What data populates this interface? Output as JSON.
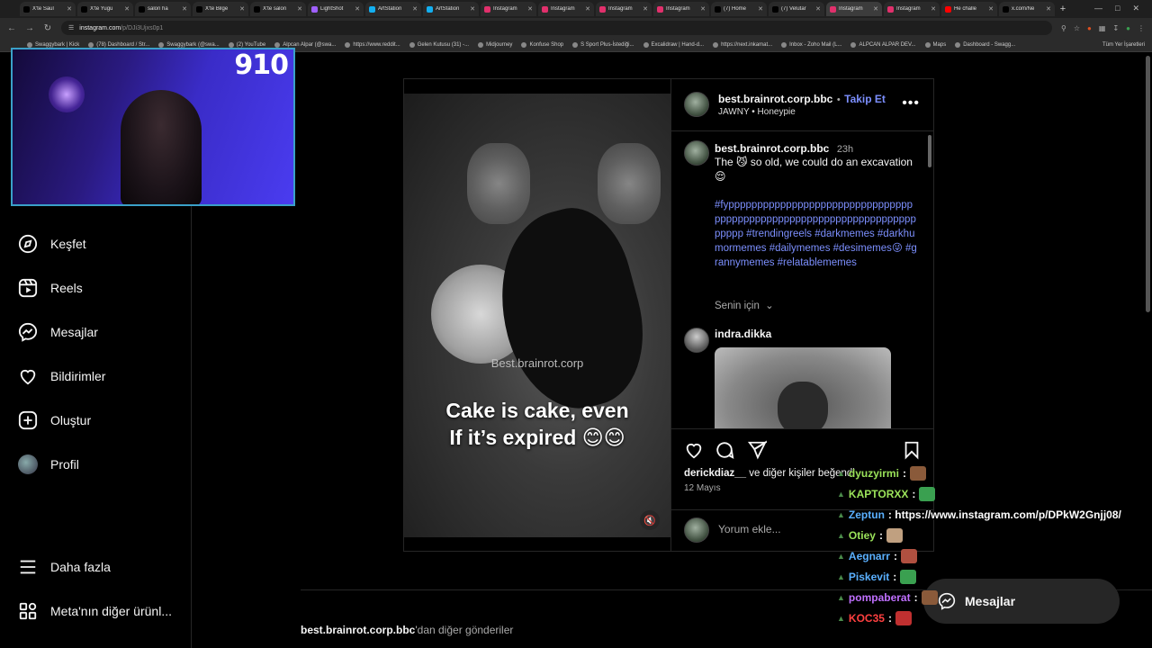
{
  "browser": {
    "tabs": [
      {
        "label": "X'te Saul",
        "color": "#000000"
      },
      {
        "label": "X'te Yugu",
        "color": "#000000"
      },
      {
        "label": "salon ha",
        "color": "#000000"
      },
      {
        "label": "X'te Bilge",
        "color": "#000000"
      },
      {
        "label": "X'te salon",
        "color": "#000000"
      },
      {
        "label": "LightShot",
        "color": "#a060ff"
      },
      {
        "label": "ArtStation",
        "color": "#13aff0"
      },
      {
        "label": "ArtStation",
        "color": "#13aff0"
      },
      {
        "label": "Instagram",
        "color": "#e1306c"
      },
      {
        "label": "Instagram",
        "color": "#e1306c"
      },
      {
        "label": "Instagram",
        "color": "#e1306c"
      },
      {
        "label": "Instagram",
        "color": "#e1306c"
      },
      {
        "label": "(7) Home",
        "color": "#000000"
      },
      {
        "label": "(7) Velutar",
        "color": "#000000"
      },
      {
        "label": "Instagram",
        "color": "#e1306c"
      },
      {
        "label": "Instagram",
        "color": "#e1306c"
      },
      {
        "label": "He challe",
        "color": "#ff0000"
      },
      {
        "label": "x.com/Ne",
        "color": "#000000"
      }
    ],
    "address": {
      "host": "instagram.com",
      "path": "/p/DJi3Ujxs0p1"
    },
    "bookmarks": [
      "Swaggybark | Kick",
      "(78) Dashboard / Str...",
      "Swaggybark (@swa...",
      "(2) YouTube",
      "Alpcan Alpar (@swa...",
      "https://www.reddit...",
      "Gelen Kutusu (31) -...",
      "Midjourney",
      "Konfuse Shop",
      "S Sport Plus-İstediği...",
      "Excalidraw | Hand-d...",
      "https://next.inkamat...",
      "Inbox - Zoho Mail (L...",
      "ALPCAN ALPAR DEV...",
      "Maps",
      "Dashboard - Swagg..."
    ],
    "bookmarks_all": "Tüm Yer İşaretleri"
  },
  "webcam": {
    "viewer_count": "910"
  },
  "sidebar": {
    "items": [
      {
        "label": "Keşfet",
        "icon": "compass-icon"
      },
      {
        "label": "Reels",
        "icon": "reels-icon"
      },
      {
        "label": "Mesajlar",
        "icon": "messenger-icon"
      },
      {
        "label": "Bildirimler",
        "icon": "heart-icon"
      },
      {
        "label": "Oluştur",
        "icon": "plus-square-icon"
      },
      {
        "label": "Profil",
        "icon": "avatar"
      }
    ],
    "more": "Daha fazla",
    "meta": "Meta'nın diğer ürünl..."
  },
  "post": {
    "media": {
      "watermark": "Best.brainrot.corp",
      "caption_line1": "Cake is cake, even",
      "caption_line2": "If it’s expired 😊😊"
    },
    "header": {
      "username": "best.brainrot.corp.bbc",
      "separator": "•",
      "follow": "Takip Et",
      "audio_artist": "JAWNY",
      "audio_dot": "•",
      "audio_track": "Honeypie"
    },
    "caption": {
      "username": "best.brainrot.corp.bbc",
      "time": "23h",
      "text": "The 😼 so old, we could do an excavation 😌",
      "hashtags": "#fypppppppppppppppppppppppppppppppppppppppppppppppppppppppppppppppppppppppp #trendingreels #darkmemes #darkhumormemes #dailymemes #desimemes😜 #grannymemes #relatablememes"
    },
    "for_you": "Senin için",
    "comment": {
      "username": "indra.dikka"
    },
    "likes": {
      "user": "derickdiaz__",
      "text": " ve diğer kişiler beğendi"
    },
    "date": "12 Mayıs",
    "add_comment_placeholder": "Yorum ekle..."
  },
  "more_posts": {
    "user": "best.brainrot.corp.bbc",
    "suffix": "'dan diğer gönderiler"
  },
  "messages_button": "Mesajlar",
  "chat": [
    {
      "user": "dyuzyirmi",
      "color": "#9be35a",
      "msg": ":",
      "emote": "#8a5a3a"
    },
    {
      "user": "KAPTORXX",
      "color": "#9be35a",
      "msg": ":",
      "emote": "#3aa050"
    },
    {
      "user": "Zeptun",
      "color": "#5ab0ff",
      "msg": ": https://www.instagram.com/p/DPkW2Gnjj08/",
      "emote": ""
    },
    {
      "user": "Otiey",
      "color": "#9be35a",
      "msg": ":",
      "emote": "#c0a080"
    },
    {
      "user": "Aegnarr",
      "color": "#5ab0ff",
      "msg": ":",
      "emote": "#b05040"
    },
    {
      "user": "Piskevit",
      "color": "#5ab0ff",
      "msg": ":",
      "emote": "#3aa050"
    },
    {
      "user": "pompaberat",
      "color": "#c070ff",
      "msg": ":",
      "emote": "#8a5a3a"
    },
    {
      "user": "KOC35",
      "color": "#ff4040",
      "msg": ":",
      "emote": "#c03030"
    }
  ]
}
